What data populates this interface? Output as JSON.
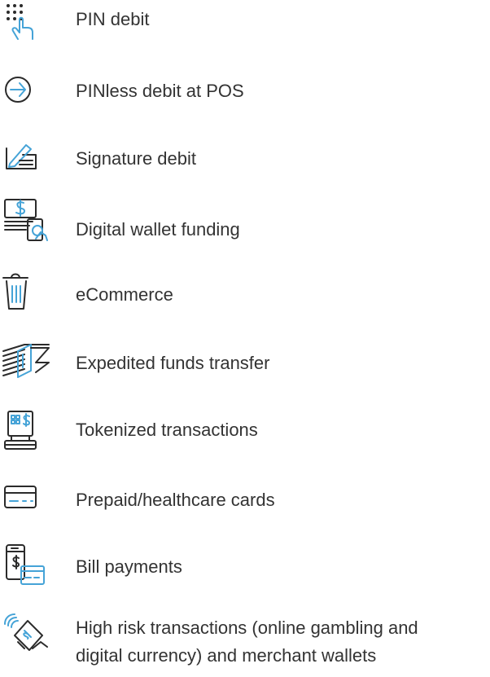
{
  "colors": {
    "text": "#333333",
    "icon_dark": "#2b2b2b",
    "icon_accent": "#45a3d7"
  },
  "items": [
    {
      "icon": "pin-keypad-icon",
      "label": "PIN debit"
    },
    {
      "icon": "arrow-circle-icon",
      "label": "PINless debit at POS"
    },
    {
      "icon": "signature-pen-icon",
      "label": "Signature debit"
    },
    {
      "icon": "digital-wallet-icon",
      "label": "Digital wallet funding"
    },
    {
      "icon": "shopping-basket-icon",
      "label": "eCommerce"
    },
    {
      "icon": "money-stack-icon",
      "label": "Expedited funds transfer"
    },
    {
      "icon": "pos-terminal-icon",
      "label": "Tokenized transactions"
    },
    {
      "icon": "card-icon",
      "label": "Prepaid/healthcare cards"
    },
    {
      "icon": "phone-card-icon",
      "label": "Bill payments"
    },
    {
      "icon": "contactless-payment-icon",
      "label_line1": "High risk transactions (online gambling and",
      "label_line2": "digital currency) and merchant wallets"
    }
  ]
}
